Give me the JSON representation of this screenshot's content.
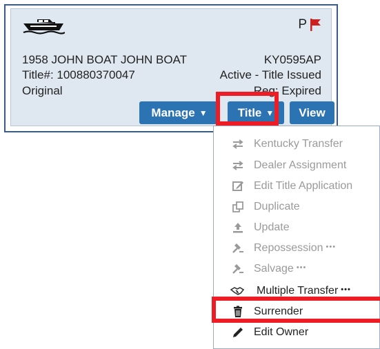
{
  "card": {
    "flag_letter": "P",
    "vehicle_description": "1958 JOHN BOAT JOHN BOAT",
    "title_number": "Title#: 100880370047",
    "title_type": "Original",
    "registration_number": "KY0595AP",
    "status": "Active - Title Issued",
    "registration_status": "Reg: Expired",
    "buttons": {
      "manage": "Manage",
      "title": "Title",
      "view": "View"
    }
  },
  "menu": {
    "items": [
      {
        "label": "Kentucky Transfer",
        "icon": "transfer-icon",
        "enabled": false
      },
      {
        "label": "Dealer Assignment",
        "icon": "transfer-icon",
        "enabled": false
      },
      {
        "label": "Edit Title Application",
        "icon": "edit-icon",
        "enabled": false
      },
      {
        "label": "Duplicate",
        "icon": "copy-icon",
        "enabled": false
      },
      {
        "label": "Update",
        "icon": "upload-icon",
        "enabled": false
      },
      {
        "label": "Repossession",
        "icon": "gavel-icon",
        "enabled": false,
        "suffix": "•••"
      },
      {
        "label": "Salvage",
        "icon": "gavel-icon",
        "enabled": false,
        "suffix": "•••"
      },
      {
        "label": "Multiple Transfer",
        "icon": "handshake-icon",
        "enabled": true,
        "suffix": "•••"
      },
      {
        "label": "Surrender",
        "icon": "trash-icon",
        "enabled": true
      },
      {
        "label": "Edit Owner",
        "icon": "pencil-icon",
        "enabled": true
      }
    ]
  },
  "colors": {
    "highlight": "#ee1c24",
    "button": "#2b73b2",
    "card_bg": "#dfe8f1",
    "flag": "#cc1f1f"
  }
}
